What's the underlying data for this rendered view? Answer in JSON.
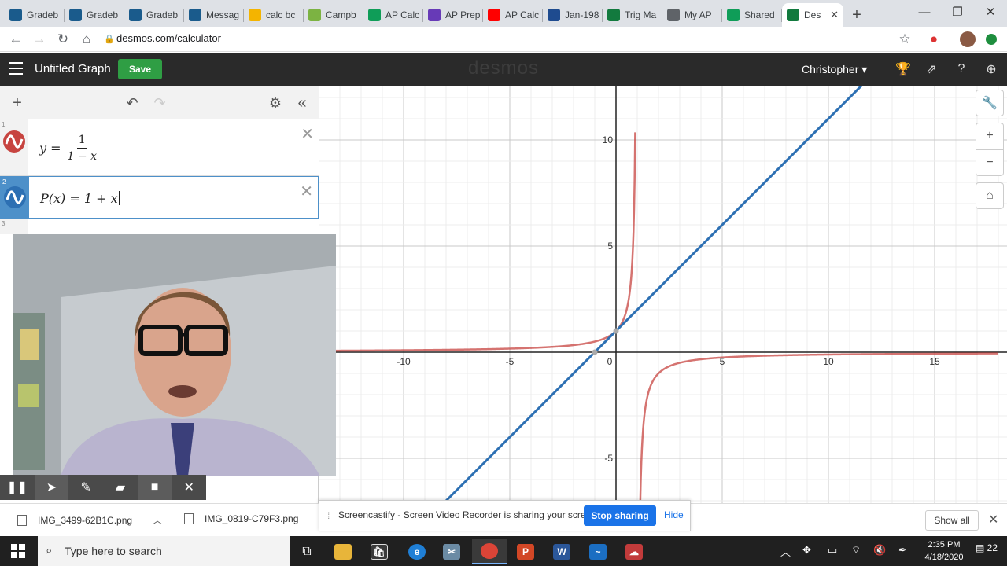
{
  "browser": {
    "tabs": [
      {
        "label": "Gradeb",
        "icon": "schoology-icon",
        "color": "#1a5b8c"
      },
      {
        "label": "Gradeb",
        "icon": "schoology-icon",
        "color": "#1a5b8c"
      },
      {
        "label": "Gradeb",
        "icon": "schoology-icon",
        "color": "#1a5b8c"
      },
      {
        "label": "Messag",
        "icon": "schoology-icon",
        "color": "#1a5b8c"
      },
      {
        "label": "calc bc",
        "icon": "slides-icon",
        "color": "#f4b400"
      },
      {
        "label": "Campb",
        "icon": "classroom-icon",
        "color": "#7cb342"
      },
      {
        "label": "AP Calc",
        "icon": "drive-icon",
        "color": "#0f9d58"
      },
      {
        "label": "AP Prep",
        "icon": "forms-icon",
        "color": "#673ab7"
      },
      {
        "label": "AP Calc",
        "icon": "youtube-icon",
        "color": "#ff0000"
      },
      {
        "label": "Jan-198",
        "icon": "mr-icon",
        "color": "#1e4b8f"
      },
      {
        "label": "Trig Ma",
        "icon": "desmos-icon",
        "color": "#127a3e"
      },
      {
        "label": "My AP",
        "icon": "globe-icon",
        "color": "#5f6368"
      },
      {
        "label": "Shared",
        "icon": "drive-icon",
        "color": "#0f9d58"
      },
      {
        "label": "Des",
        "icon": "desmos-icon",
        "color": "#127a3e"
      }
    ],
    "url": "desmos.com/calculator"
  },
  "desmos": {
    "graph_title": "Untitled Graph",
    "save_label": "Save",
    "logo": "desmos",
    "user_name": "Christopher",
    "expressions": [
      {
        "index": "1",
        "lhs": "y =",
        "numerator": "1",
        "denominator": "1 − x",
        "color": "#c74440"
      },
      {
        "index": "2",
        "text": "P(x) = 1 + x",
        "color": "#2d70b3"
      },
      {
        "index": "3"
      }
    ],
    "axes": {
      "x_ticks": [
        "-10",
        "-5",
        "0",
        "5",
        "10",
        "15"
      ],
      "y_ticks": [
        "10",
        "5",
        "-5"
      ]
    }
  },
  "screencastify": {
    "message": "Screencastify - Screen Video Recorder is sharing your screen.",
    "stop_label": "Stop sharing",
    "hide_label": "Hide"
  },
  "downloads": {
    "items": [
      "IMG_3499-62B1C.png",
      "IMG_0819-C79F3.png"
    ],
    "show_all": "Show all"
  },
  "taskbar": {
    "search_placeholder": "Type here to search",
    "time": "2:35 PM",
    "date": "4/18/2020",
    "notification_count": "22"
  }
}
